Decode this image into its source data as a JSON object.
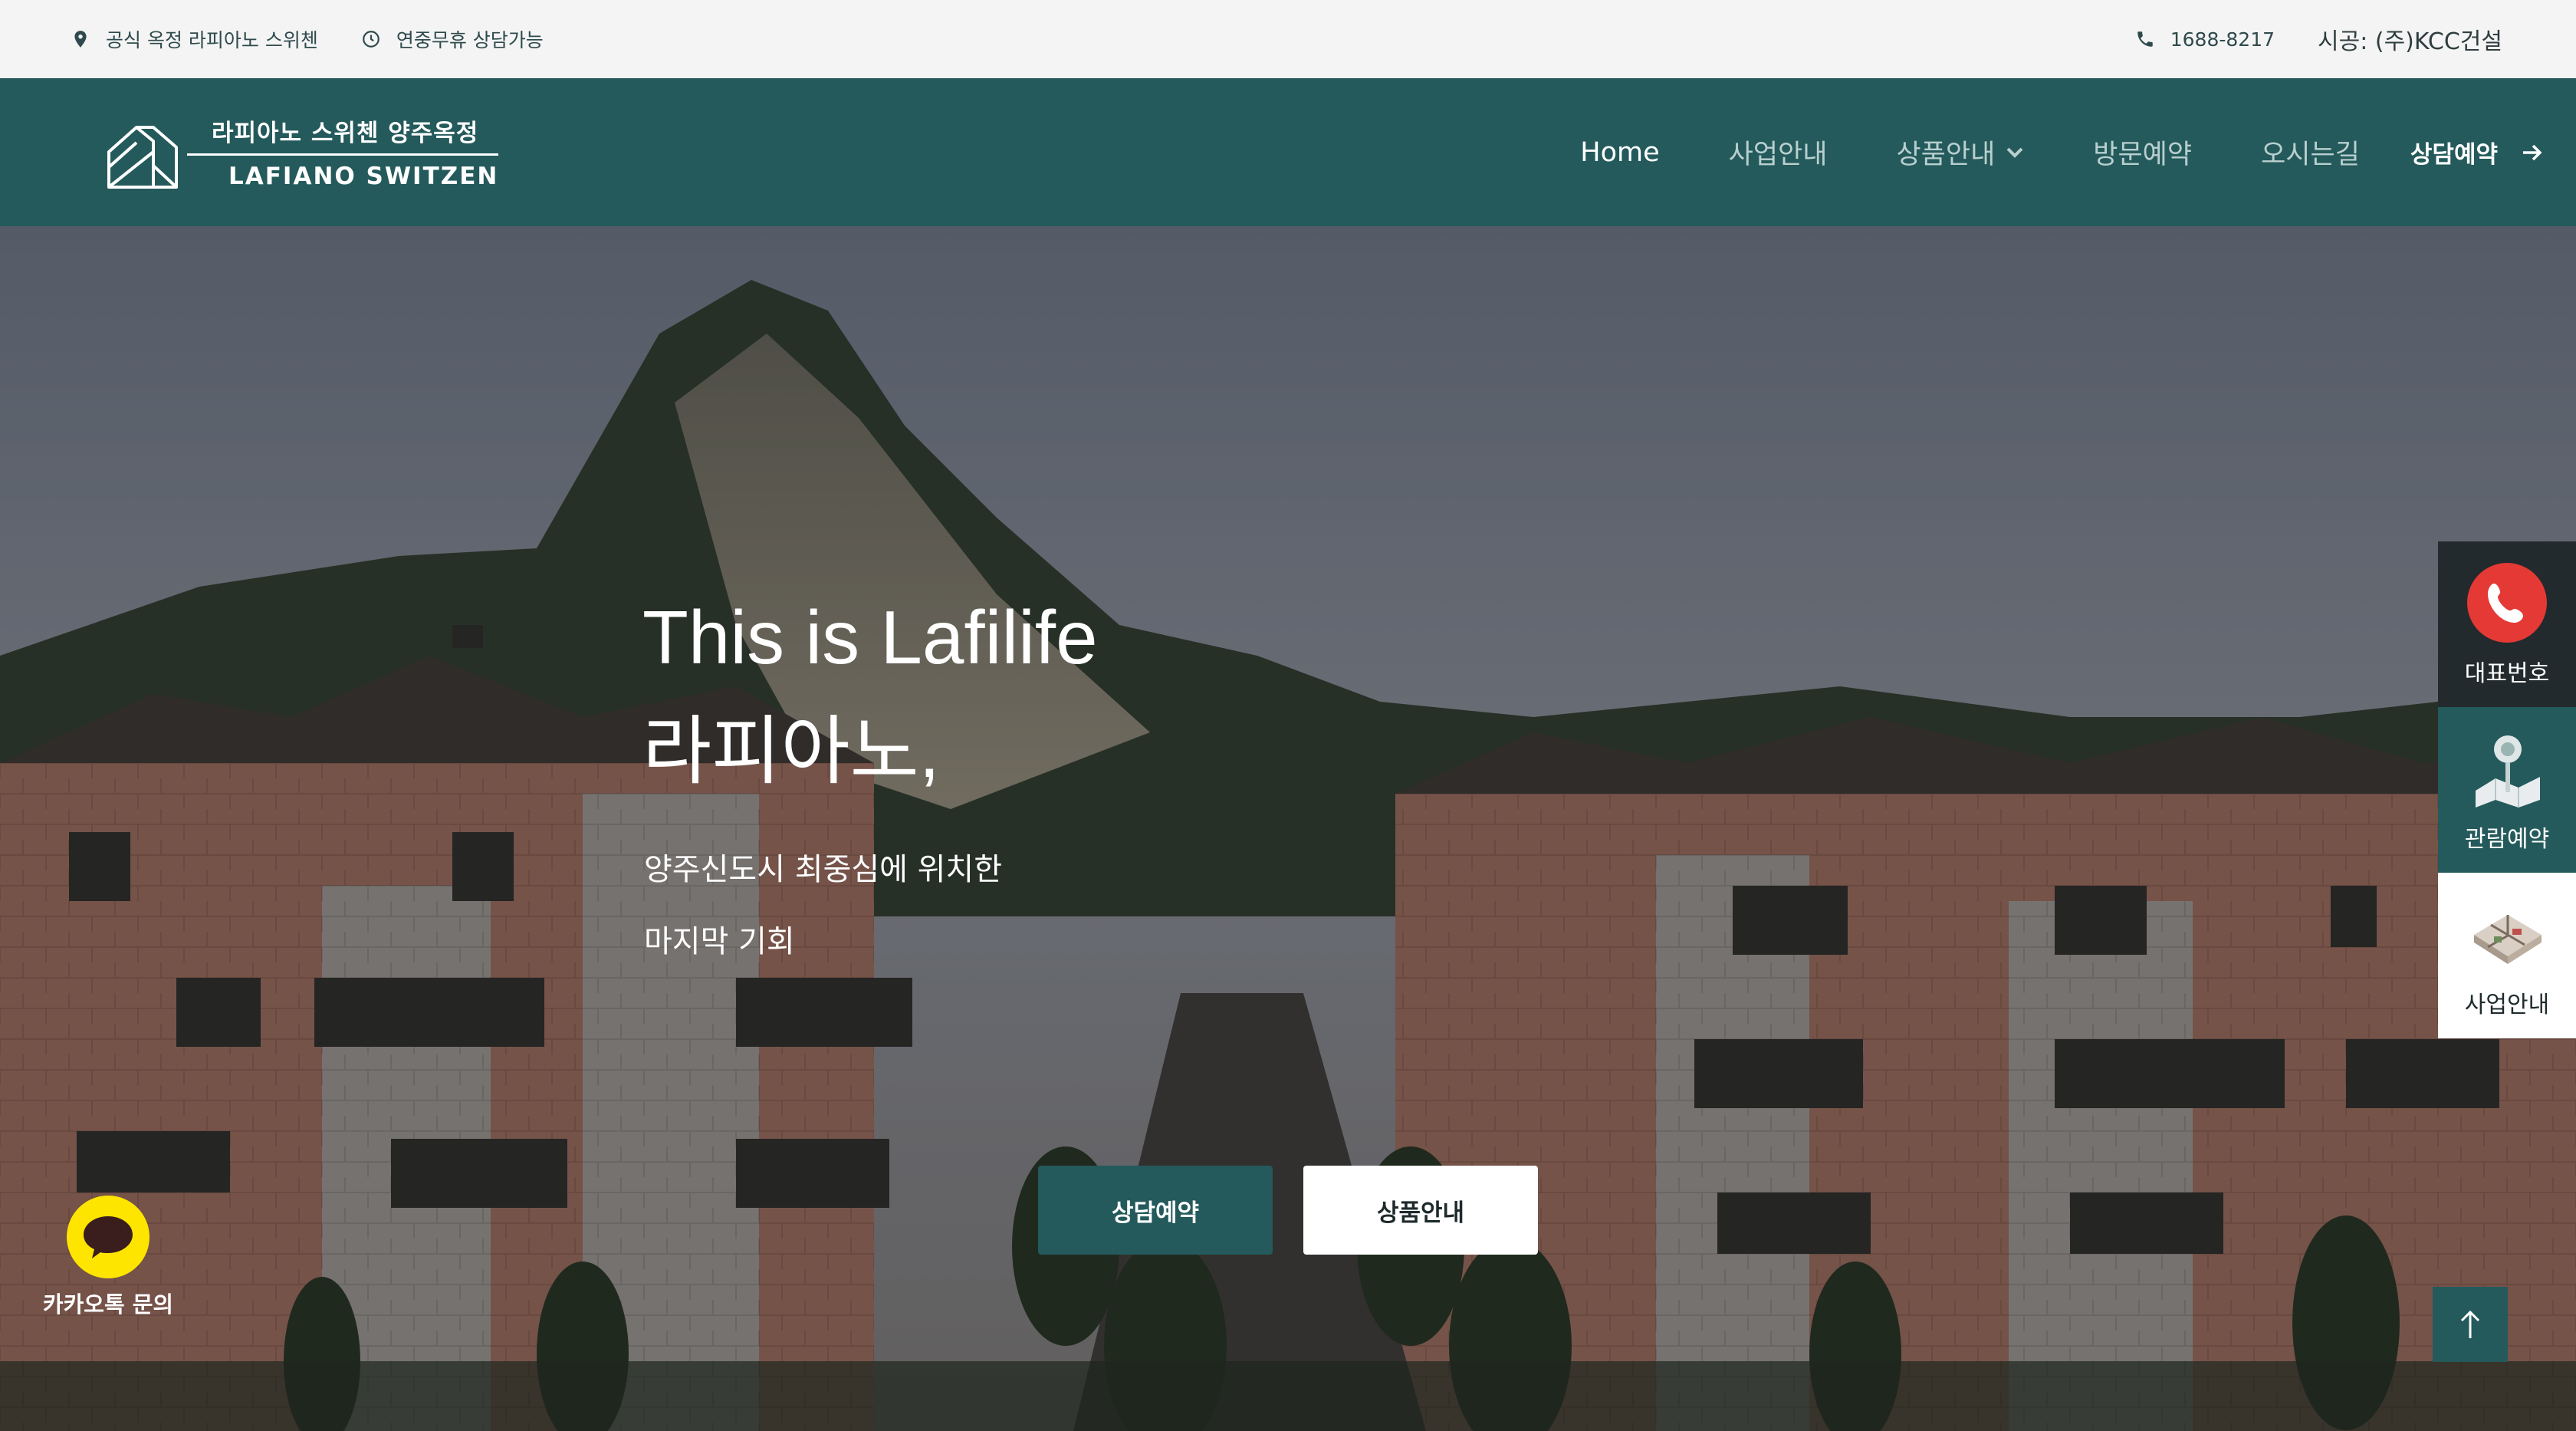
{
  "topbar": {
    "location_text": "공식 옥정 라피아노 스위첸",
    "hours_text": "연중무휴 상담가능",
    "phone": "1688-8217",
    "builder": "시공: (주)KCC건설",
    "icons": {
      "location": "location-pin-icon",
      "clock": "clock-icon",
      "phone": "phone-icon"
    }
  },
  "header": {
    "logo_ko": "라피아노 스위첸 양주옥정",
    "logo_en": "LAFIANO SWITZEN",
    "nav": {
      "home": "Home",
      "business": "사업안내",
      "products": "상품안내",
      "visit": "방문예약",
      "directions": "오시는길",
      "consult": "상담예약"
    }
  },
  "hero": {
    "title_line1": "This is Lafilife",
    "title_line2": "라피아노,",
    "subtitle_line1": "양주신도시 최중심에 위치한",
    "subtitle_line2": "마지막 기회",
    "btn_consult": "상담예약",
    "btn_products": "상품안내"
  },
  "quick_panel": {
    "phone_label": "대표번호",
    "visit_label": "관람예약",
    "business_label": "사업안내"
  },
  "kakao": {
    "label": "카카오톡 문의"
  },
  "colors": {
    "brand_teal": "#245a5b",
    "topbar_bg": "#f4f4f4",
    "kakao_yellow": "#fee500",
    "phone_red": "#e53935"
  }
}
